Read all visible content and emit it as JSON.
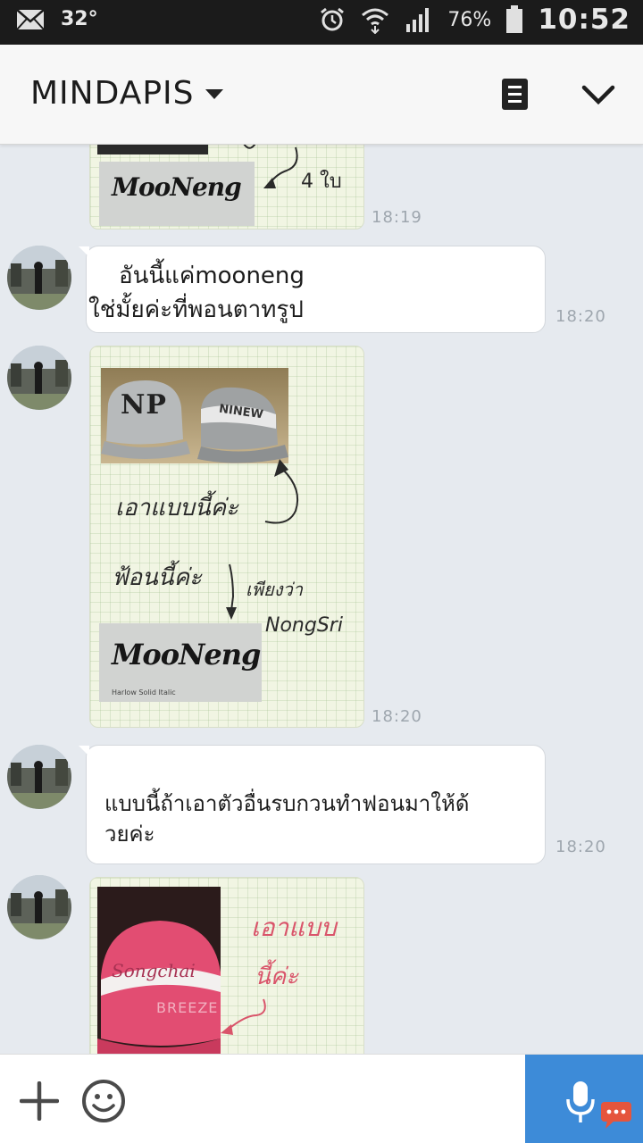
{
  "status_bar": {
    "temperature": "32°",
    "battery": "76%",
    "time": "10:52"
  },
  "header": {
    "chat_name": "MINDAPIS"
  },
  "messages": [
    {
      "kind": "note",
      "sender": "self",
      "time": "18:19",
      "handwriting": "4 ใบ",
      "logo": "MooNeng"
    },
    {
      "kind": "text",
      "sender": "contact",
      "time": "18:20",
      "line1": "อันนี้แค่mooneng",
      "line2": "ใช่มั้ยค่ะที่พอนตาทรูป"
    },
    {
      "kind": "note",
      "sender": "contact",
      "time": "18:20",
      "cap1": "NP",
      "cap2": "NINEW",
      "handwriting1": "เอาแบบนี้ค่ะ",
      "handwriting2": "ฟ้อนนี้ค่ะ",
      "handwriting3": "เพียงว่า",
      "handwriting4": "NongSri",
      "logo": "MooNeng",
      "logo_sub": "Harlow Solid Italic"
    },
    {
      "kind": "text",
      "sender": "contact",
      "time": "18:20",
      "line1": "แบบนี้ถ้าเอาตัวอื่นรบกวนทำฟอนมาให้ด้",
      "line2": "วยค่ะ"
    },
    {
      "kind": "note",
      "sender": "contact",
      "cap_text": "Songchai",
      "watermark": "BREEZE",
      "handwriting1": "เอาแบบ",
      "handwriting2": "นี้ค่ะ"
    }
  ]
}
